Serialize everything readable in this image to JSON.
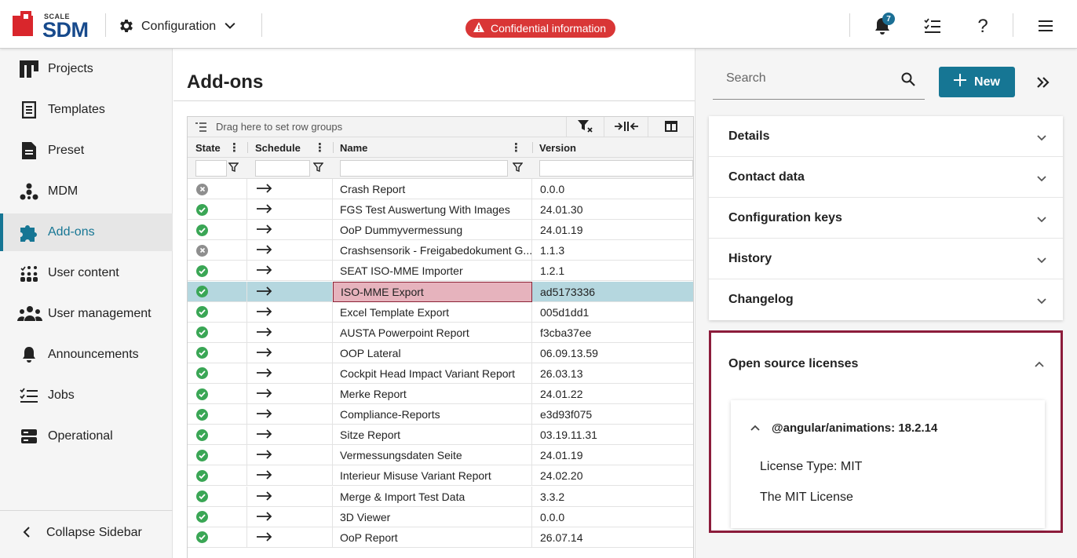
{
  "brand": {
    "top": "SCALE",
    "name": "SDM"
  },
  "header": {
    "config_label": "Configuration",
    "confidential_label": "Confidential information",
    "notification_count": "7",
    "help_label": "?"
  },
  "sidebar": {
    "items": [
      {
        "label": "Projects",
        "icon": "projects-icon"
      },
      {
        "label": "Templates",
        "icon": "templates-icon"
      },
      {
        "label": "Preset",
        "icon": "preset-icon"
      },
      {
        "label": "MDM",
        "icon": "mdm-icon"
      },
      {
        "label": "Add-ons",
        "icon": "puzzle-icon",
        "active": true
      },
      {
        "label": "User content",
        "icon": "user-content-icon"
      },
      {
        "label": "User management",
        "icon": "users-icon"
      },
      {
        "label": "Announcements",
        "icon": "bell-icon"
      },
      {
        "label": "Jobs",
        "icon": "jobs-icon"
      },
      {
        "label": "Operational",
        "icon": "server-icon"
      }
    ],
    "collapse_label": "Collapse Sidebar"
  },
  "main": {
    "title": "Add-ons",
    "grid": {
      "group_hint": "Drag here to set row groups",
      "columns": [
        "State",
        "Schedule",
        "Name",
        "Version"
      ],
      "rows": [
        {
          "state": "error",
          "name": "Crash Report",
          "version": "0.0.0"
        },
        {
          "state": "ok",
          "name": "FGS Test Auswertung With Images",
          "version": "24.01.30"
        },
        {
          "state": "ok",
          "name": "OoP Dummyvermessung",
          "version": "24.01.19"
        },
        {
          "state": "error",
          "name": "Crashsensorik - Freigabedokument G...",
          "version": "1.1.3"
        },
        {
          "state": "ok",
          "name": "SEAT ISO-MME Importer",
          "version": "1.2.1"
        },
        {
          "state": "ok",
          "name": "ISO-MME Export",
          "version": "ad5173336",
          "selected": true
        },
        {
          "state": "ok",
          "name": "Excel Template Export",
          "version": "005d1dd1"
        },
        {
          "state": "ok",
          "name": "AUSTA Powerpoint Report",
          "version": "f3cba37ee"
        },
        {
          "state": "ok",
          "name": "OOP Lateral",
          "version": "06.09.13.59"
        },
        {
          "state": "ok",
          "name": "Cockpit Head Impact Variant Report",
          "version": "26.03.13"
        },
        {
          "state": "ok",
          "name": "Merke Report",
          "version": "24.01.22"
        },
        {
          "state": "ok",
          "name": "Compliance-Reports",
          "version": "e3d93f075"
        },
        {
          "state": "ok",
          "name": "Sitze Report",
          "version": "03.19.11.31"
        },
        {
          "state": "ok",
          "name": "Vermessungsdaten Seite",
          "version": "24.01.19"
        },
        {
          "state": "ok",
          "name": "Interieur Misuse Variant Report",
          "version": "24.02.20"
        },
        {
          "state": "ok",
          "name": "Merge & Import Test Data",
          "version": "3.3.2"
        },
        {
          "state": "ok",
          "name": "3D Viewer",
          "version": "0.0.0"
        },
        {
          "state": "ok",
          "name": "OoP Report",
          "version": "26.07.14"
        }
      ]
    }
  },
  "right": {
    "search_placeholder": "Search",
    "new_label": "New",
    "sections": [
      "Details",
      "Contact data",
      "Configuration keys",
      "History",
      "Changelog"
    ],
    "oss": {
      "title": "Open source licenses",
      "package": "@angular/animations: 18.2.14",
      "license_type": "License Type: MIT",
      "license_name": "The MIT License"
    }
  },
  "colors": {
    "accent": "#167694",
    "brand_red": "#d9262c",
    "brand_blue": "#174a8c",
    "confidential": "#d93636",
    "ok": "#3aa655",
    "error": "#8e8e8e",
    "selected_row": "#b5d7df",
    "highlight_border": "#8c1c3b"
  }
}
